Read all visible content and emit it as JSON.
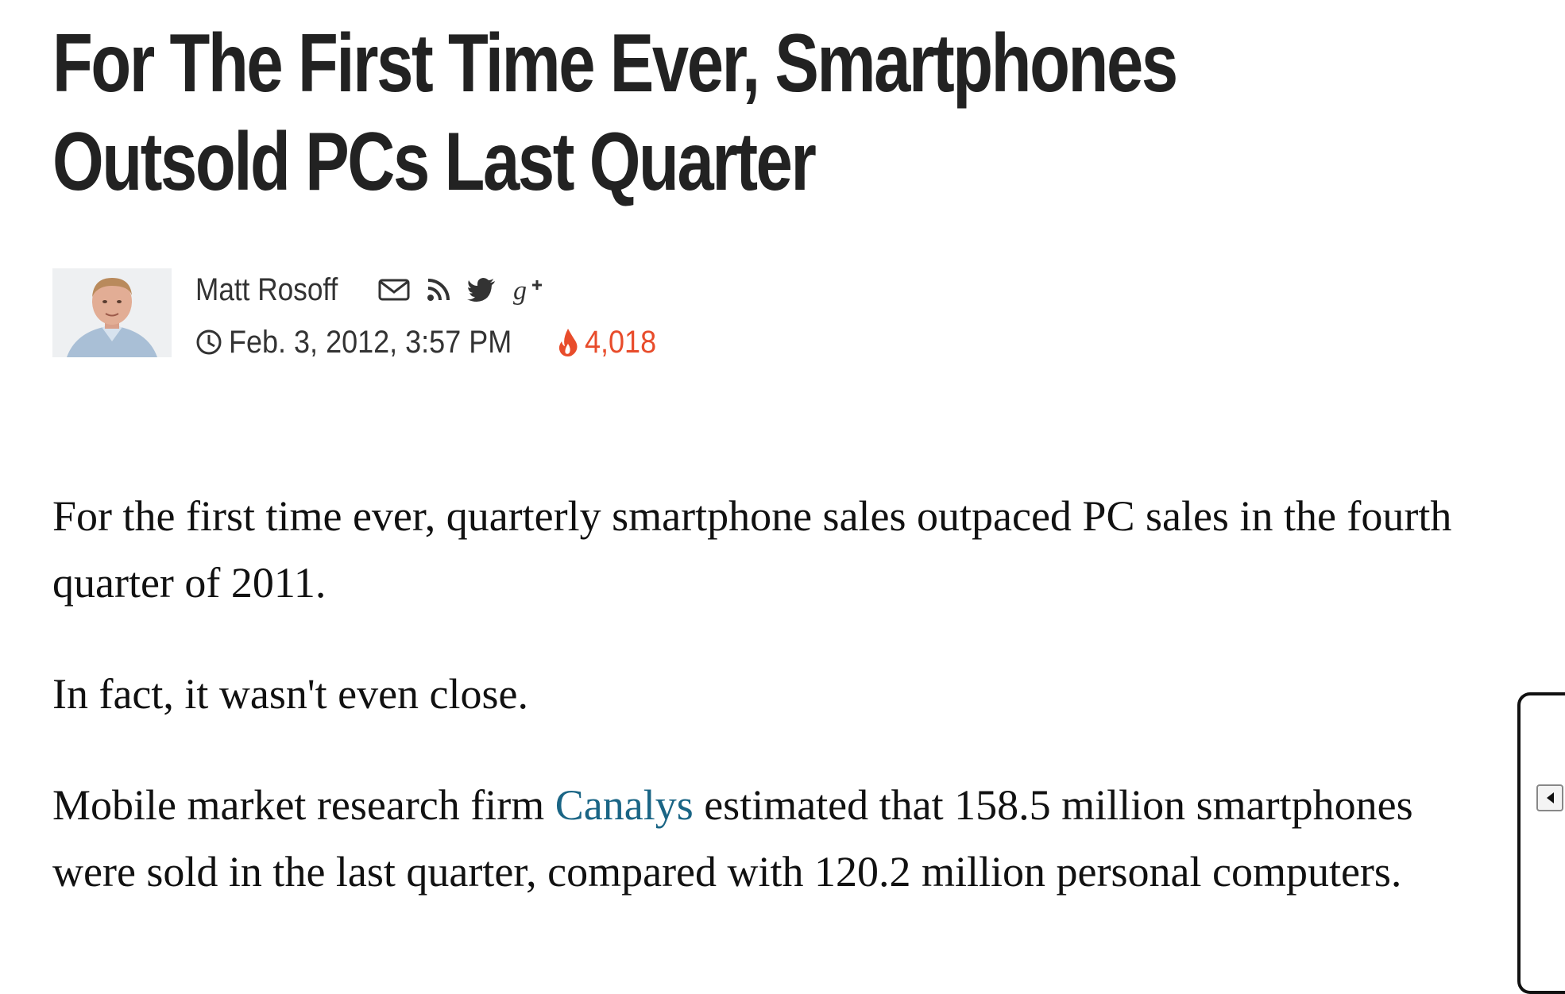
{
  "article": {
    "headline_line1": "For The First Time Ever, Smartphones",
    "headline_line2": "Outsold PCs Last Quarter",
    "author": "Matt Rosoff",
    "date": "Feb. 3, 2012, 3:57 PM",
    "views": "4,018",
    "paragraphs": {
      "p1": "For the first time ever, quarterly smartphone sales outpaced PC sales in the fourth quarter of 2011.",
      "p2": "In fact, it wasn't even close.",
      "p3_before": "Mobile market research firm ",
      "p3_link": "Canalys",
      "p3_after": " estimated that 158.5 million smartphones were sold in the last quarter, compared with 120.2 million personal computers."
    }
  },
  "icons": {
    "social": [
      "mail-icon",
      "rss-icon",
      "twitter-icon",
      "google-plus-icon"
    ],
    "meta": [
      "clock-icon",
      "fire-icon"
    ],
    "panel": "caret-left-icon"
  },
  "colors": {
    "text": "#222222",
    "views": "#e84c2b",
    "link": "#1a6585"
  }
}
